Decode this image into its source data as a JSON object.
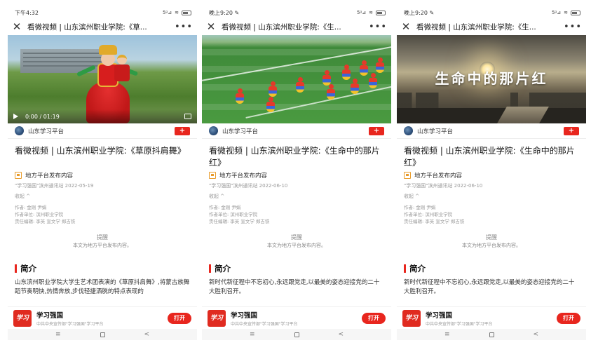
{
  "phones": [
    {
      "status": {
        "time": "下午4:32",
        "signal": "5ᵍ⊿",
        "wifi": "≋"
      },
      "title": "看微视频 | 山东滨州职业学院:《草...",
      "more": "•••",
      "video": {
        "time": "0:00 / 01:19"
      },
      "source": {
        "name": "山东学习平台",
        "follow": "+"
      },
      "article_title": "看微视频 | 山东滨州职业学院:《草原抖肩舞》",
      "tag": "地方平台发布内容",
      "meta": "\"学习强国\"滨州通讯站  2022-05-19",
      "collapse": "收起 ^",
      "author": "作者: 金刚 尹娟",
      "unit": "作者单位: 滨州职业学院",
      "editor": "责任编辑: 李英 宣文学 郑吉铁",
      "notice_title": "提醒",
      "notice_text": "本文为地方平台发布内容。",
      "section": "简介",
      "intro": "山东滨州职业学院大学生艺术团表演的《草原抖肩舞》,将蒙古族舞蹈节奏明快,热情奔放,步伐轻捷洒脱的特点表现的",
      "app": {
        "name": "学习强国",
        "sub": "中共中央宣传部\"学习强国\"学习平台",
        "open": "打开",
        "logo": "学习"
      },
      "nav": {
        "menu": "≡",
        "back": "<"
      }
    },
    {
      "status": {
        "time": "晚上9:20 ✎",
        "signal": "5ᵍ⊿",
        "wifi": "≋"
      },
      "title": "看微视频 | 山东滨州职业学院:《生...",
      "more": "•••",
      "source": {
        "name": "山东学习平台",
        "follow": "+"
      },
      "article_title": "看微视频 | 山东滨州职业学院:《生命中的那片红》",
      "tag": "地方平台发布内容",
      "meta": "\"学习强国\"滨州通讯站  2022-06-10",
      "collapse": "收起 ^",
      "author": "作者: 金刚 尹娟",
      "unit": "作者单位: 滨州职业学院",
      "editor": "责任编辑: 李英 宣文学 郑吉铁",
      "notice_title": "提醒",
      "notice_text": "本文为地方平台发布内容。",
      "section": "简介",
      "intro": "新时代新征程中不忘初心,永远跟党走,以最美的姿态迎接党的二十大胜利召开。",
      "app": {
        "name": "学习强国",
        "sub": "中共中央宣传部\"学习强国\"学习平台",
        "open": "打开",
        "logo": "学习"
      },
      "nav": {
        "menu": "≡",
        "back": "<"
      }
    },
    {
      "status": {
        "time": "晚上9:20 ✎",
        "signal": "5ᵍ⊿",
        "wifi": "≋"
      },
      "title": "看微视频 | 山东滨州职业学院:《生...",
      "more": "•••",
      "video": {
        "overlay_title": "生命中的那片红"
      },
      "source": {
        "name": "山东学习平台",
        "follow": "+"
      },
      "article_title": "看微视频 | 山东滨州职业学院:《生命中的那片红》",
      "tag": "地方平台发布内容",
      "meta": "\"学习强国\"滨州通讯站  2022-06-10",
      "collapse": "收起 ^",
      "author": "作者: 金刚 尹娟",
      "unit": "作者单位: 滨州职业学院",
      "editor": "责任编辑: 李英 宣文学 郑吉铁",
      "notice_title": "提醒",
      "notice_text": "本文为地方平台发布内容。",
      "section": "简介",
      "intro": "新时代新征程中不忘初心,永远跟党走,以最美的姿态迎接党的二十大胜利召开。",
      "app": {
        "name": "学习强国",
        "sub": "中共中央宣传部\"学习强国\"学习平台",
        "open": "打开",
        "logo": "学习"
      },
      "nav": {
        "menu": "≡",
        "back": "<"
      }
    }
  ],
  "colors": {
    "accent": "#e8261e",
    "tag": "#e89b2a",
    "meta": "#999999"
  }
}
